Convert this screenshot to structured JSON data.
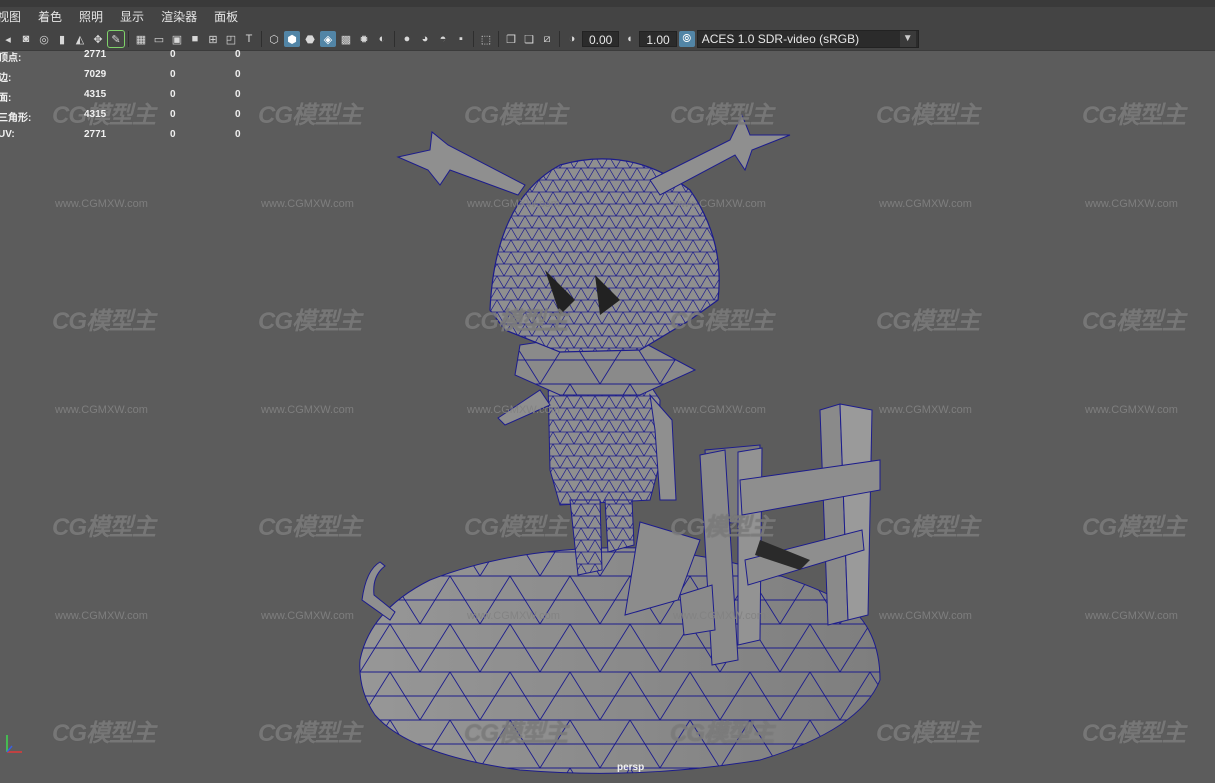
{
  "menu": [
    "视图",
    "着色",
    "照明",
    "显示",
    "渲染器",
    "面板"
  ],
  "toolbar": {
    "exposure_value": "0.00",
    "gamma_value": "1.00",
    "color_space": "ACES 1.0 SDR-video (sRGB)"
  },
  "hud": {
    "rows": [
      {
        "label": "顶点:",
        "v1": "2771",
        "v2": "0",
        "v3": "0"
      },
      {
        "label": "边:",
        "v1": "7029",
        "v2": "0",
        "v3": "0"
      },
      {
        "label": "面:",
        "v1": "4315",
        "v2": "0",
        "v3": "0"
      },
      {
        "label": "三角形:",
        "v1": "4315",
        "v2": "0",
        "v3": "0"
      },
      {
        "label": "UV:",
        "v1": "2771",
        "v2": "0",
        "v3": "0"
      }
    ]
  },
  "viewport": {
    "camera_label": "persp",
    "watermark_logo": "CG模型主",
    "watermark_url": "www.CGMXW.com"
  },
  "colors": {
    "viewport_bg": "#5c5c5c",
    "mesh_fill": "#8f8f8f",
    "wire": "#1a1a8a",
    "toolbar_bg": "#444444",
    "active_icon": "#5285a6"
  }
}
